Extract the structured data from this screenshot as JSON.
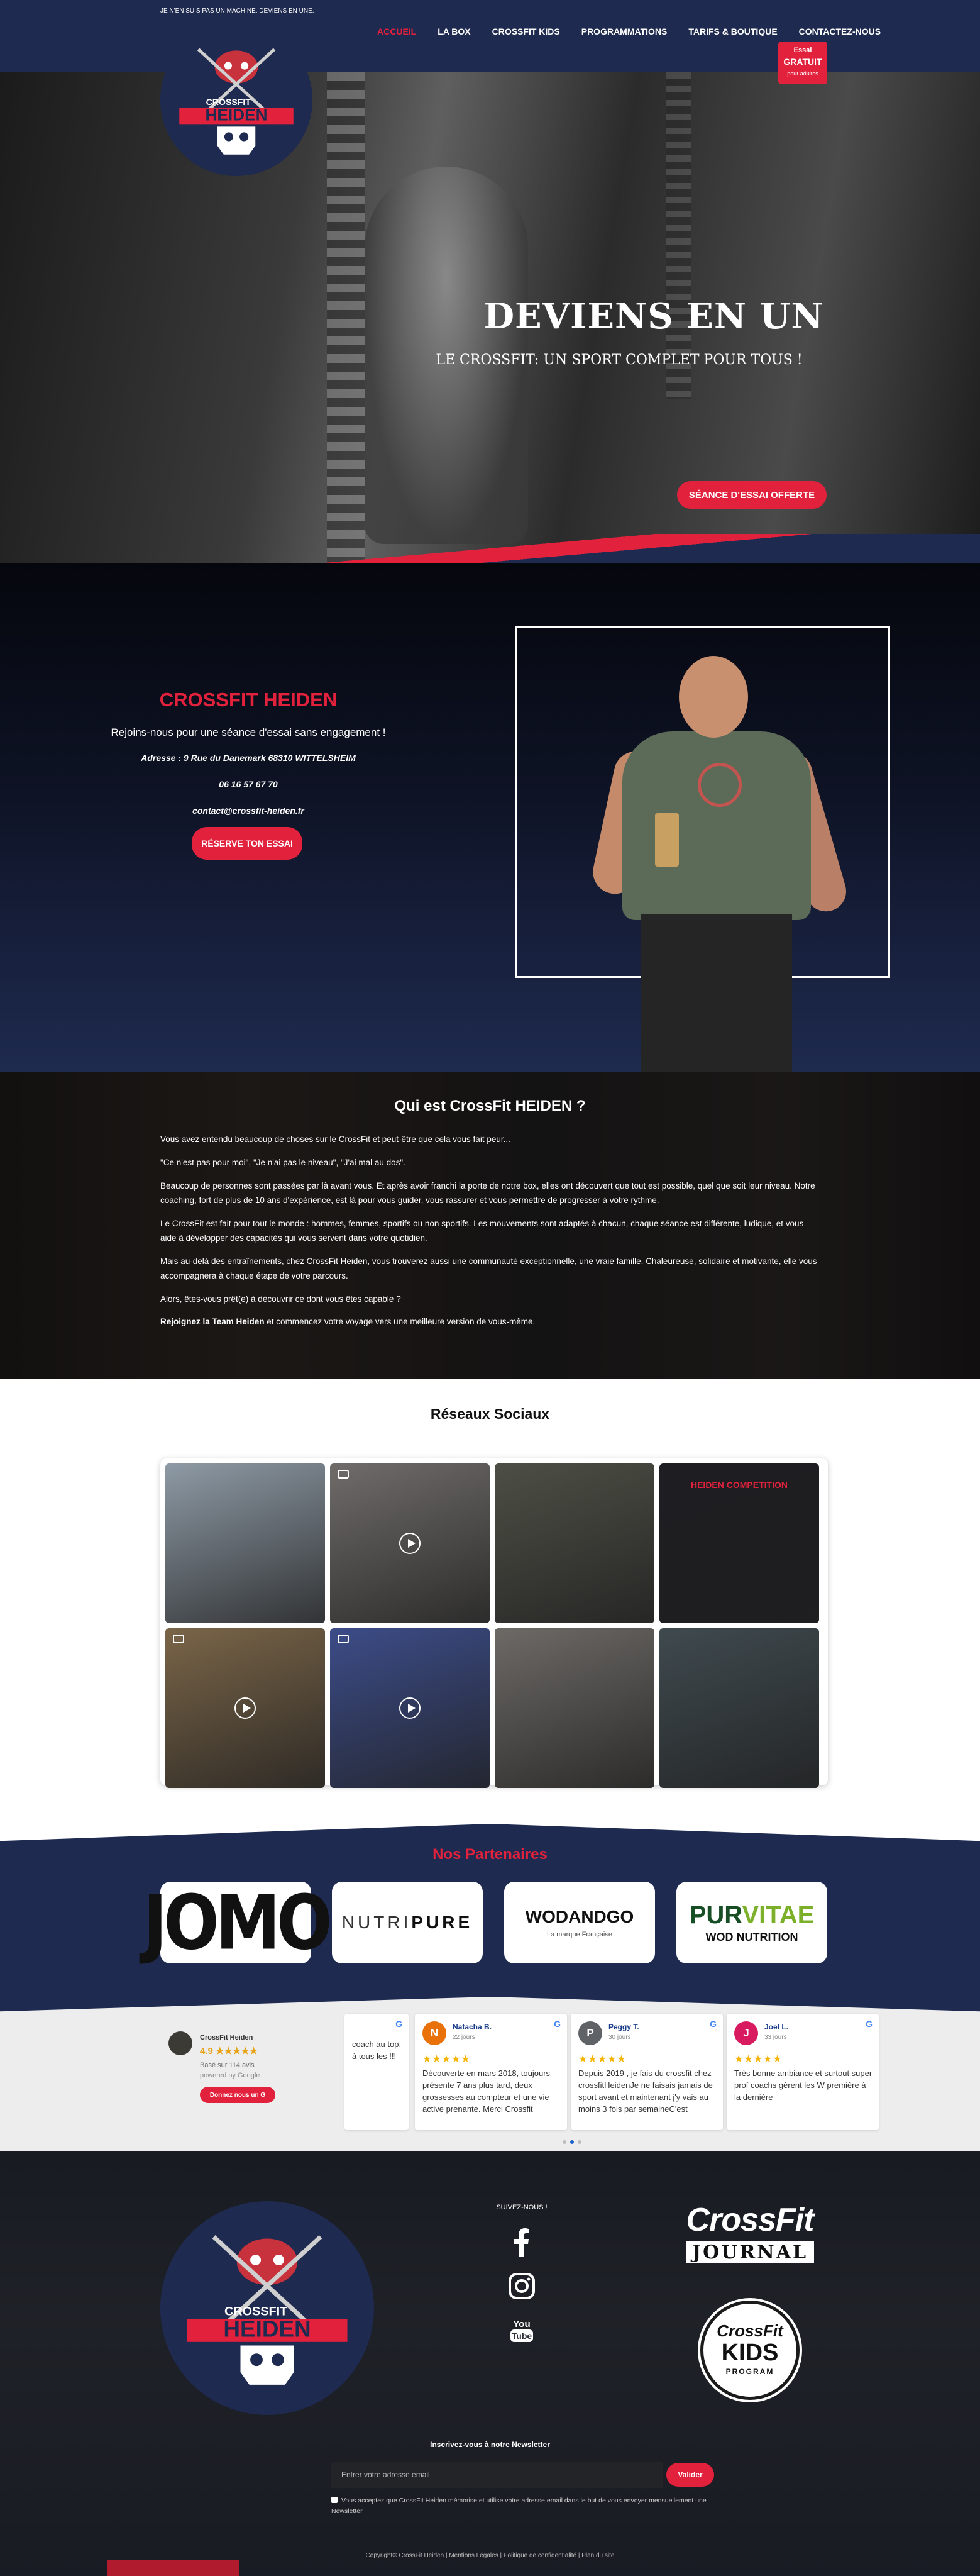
{
  "header": {
    "tagline": "JE N'EN SUIS PAS UN MACHINE. DEVIENS EN UNE.",
    "nav": [
      {
        "label": "ACCUEIL",
        "active": true
      },
      {
        "label": "LA BOX",
        "active": false
      },
      {
        "label": "CROSSFIT KIDS",
        "active": false
      },
      {
        "label": "PROGRAMMATIONS",
        "active": false
      },
      {
        "label": "TARIFS & BOUTIQUE",
        "active": false
      },
      {
        "label": "CONTACTEZ-NOUS",
        "active": false
      }
    ],
    "trial_badge": {
      "line1": "Essai",
      "line2": "GRATUIT",
      "line3": "pour adultes"
    }
  },
  "logo": {
    "top": "CROSSFIT",
    "name": "HEIDEN"
  },
  "hero": {
    "title": "DEVIENS EN UN",
    "subtitle": "LE CROSSFIT: UN SPORT COMPLET POUR TOUS !",
    "cta": "SÉANCE D'ESSAI OFFERTE"
  },
  "intro": {
    "title": "CROSSFIT HEIDEN",
    "subtitle": "Rejoins-nous pour une séance d'essai sans engagement !",
    "address": "Adresse : 9 Rue du Danemark 68310 WITTELSHEIM",
    "phone": "06 16 57 67 70",
    "email": "contact@crossfit-heiden.fr",
    "cta": "RÉSERVE TON ESSAI"
  },
  "about": {
    "title": "Qui est CrossFit HEIDEN ?",
    "paragraphs": [
      "Vous avez entendu beaucoup de choses sur le CrossFit et peut-être que cela vous fait peur...",
      "\"Ce n'est pas pour moi\", \"Je n'ai pas le niveau\", \"J'ai mal au dos\".",
      "Beaucoup de personnes sont passées par là avant vous. Et après avoir franchi la porte de notre box, elles ont découvert que tout est possible, quel que soit leur niveau. Notre coaching, fort de plus de 10 ans d'expérience, est là pour vous guider, vous rassurer et vous permettre de progresser à votre rythme.",
      "Le CrossFit est fait pour tout le monde : hommes, femmes, sportifs ou non sportifs. Les mouvements sont adaptés à chacun, chaque séance est différente, ludique, et vous aide à développer des capacités qui vous servent dans votre quotidien.",
      "Mais au-delà des entraînements, chez CrossFit Heiden, vous trouverez aussi une communauté exceptionnelle, une vraie famille. Chaleureuse, solidaire et motivante, elle vous accompagnera à chaque étape de votre parcours.",
      "Alors, êtes-vous prêt(e) à découvrir ce dont vous êtes capable ?"
    ],
    "closing_bold": "Rejoignez la Team Heiden",
    "closing_rest": " et commencez votre voyage vers une meilleure version de vous-même."
  },
  "social": {
    "title": "Réseaux Sociaux",
    "tiles": [
      {
        "kind": "photo",
        "color": "#8e9aa5"
      },
      {
        "kind": "video",
        "color": "#6f6c6a"
      },
      {
        "kind": "photo",
        "color": "#4d4f45"
      },
      {
        "kind": "poster",
        "color": "#1d1d22",
        "label": "HEIDEN COMPETITION"
      },
      {
        "kind": "video",
        "color": "#7a6548"
      },
      {
        "kind": "video",
        "color": "#3c4c88"
      },
      {
        "kind": "photo",
        "color": "#6d6a66"
      },
      {
        "kind": "photo",
        "color": "#3f4a4f"
      }
    ]
  },
  "partners": {
    "title": "Nos Partenaires",
    "items": [
      {
        "name": "JOMO"
      },
      {
        "name_light": "NUTRI",
        "name_bold": "PURE"
      },
      {
        "name": "WODANDGO",
        "tagline": "La marque Française"
      },
      {
        "name_a": "PUR",
        "name_b": "VITAE",
        "tagline": "WOD NUTRITION"
      }
    ]
  },
  "reviews": {
    "brand": {
      "name": "CrossFit Heiden",
      "score": "4.9 ★★★★★",
      "count": "Basé sur 114 avis",
      "powered": "powered by Google",
      "button": "Donnez nous un G"
    },
    "cards": [
      {
        "initial": "",
        "name": "",
        "when": "",
        "color": "#ffffff",
        "text": "coach au top, à tous les !!!",
        "partial": true
      },
      {
        "initial": "N",
        "name": "Natacha B.",
        "when": "22 jours",
        "color": "#e8710a",
        "text": "Découverte en mars 2018, toujours présente 7 ans plus tard, deux grossesses au compteur et une vie active prenante. Merci Crossfit"
      },
      {
        "initial": "P",
        "name": "Peggy T.",
        "when": "30 jours",
        "color": "#5f6368",
        "text": "Depuis 2019 , je fais du crossfit chez crossfitHeidenJe ne faisais jamais de sport avant et maintenant j'y vais au moins 3 fois par semaineC'est"
      },
      {
        "initial": "J",
        "name": "Joel L.",
        "when": "33 jours",
        "color": "#d81b60",
        "text": "Très bonne ambiance et surtout super prof coachs gèrent les W première à la dernière"
      }
    ]
  },
  "footer": {
    "follow": "SUIVEZ-NOUS !",
    "journal_a": "CrossFit",
    "journal_b": "JOURNAL",
    "kids_a": "CrossFit",
    "kids_b": "KIDS",
    "kids_c": "PROGRAM",
    "newsletter_title": "Inscrivez-vous à notre Newsletter",
    "newsletter_placeholder": "Entrer votre adresse email",
    "newsletter_button": "Valider",
    "consent": "Vous acceptez que CrossFit Heiden mémorise et utilise votre adresse email dans le but de vous envoyer mensuellement une Newsletter.",
    "copyright": "Copyright© CrossFit Heiden | Mentions Légales | Politique de confidentialité | Plan du site"
  },
  "colors": {
    "navy": "#1e2a4f",
    "accent_red": "#e2213d"
  }
}
